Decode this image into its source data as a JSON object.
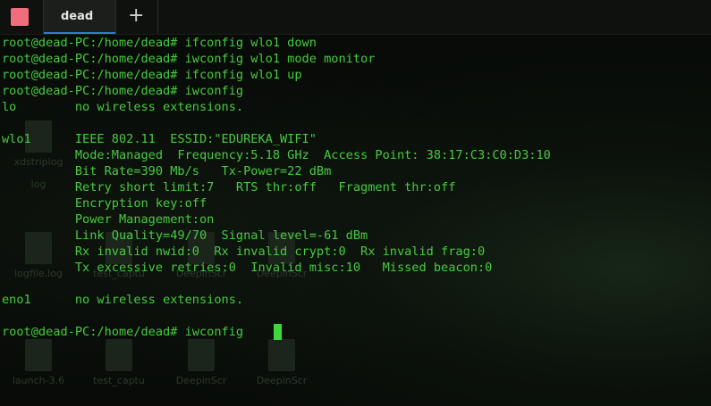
{
  "tab": {
    "label": "dead",
    "new_tab": "+"
  },
  "desktop_icons": [
    {
      "label": "xdstriplog"
    },
    {
      "label": "log"
    },
    {
      "label": "logfile.log"
    },
    {
      "label": "test_captu"
    },
    {
      "label": "DeepinScr"
    },
    {
      "label": "DeepinScr"
    },
    {
      "label": "launch-3.6"
    },
    {
      "label": "test_captu"
    },
    {
      "label": "DeepinScr"
    },
    {
      "label": "DeepinScr"
    }
  ],
  "terminal": {
    "lines": [
      "root@dead-PC:/home/dead# ifconfig wlo1 down",
      "root@dead-PC:/home/dead# iwconfig wlo1 mode monitor",
      "root@dead-PC:/home/dead# ifconfig wlo1 up",
      "root@dead-PC:/home/dead# iwconfig",
      "lo        no wireless extensions.",
      "",
      "wlo1      IEEE 802.11  ESSID:\"EDUREKA_WIFI\"",
      "          Mode:Managed  Frequency:5.18 GHz  Access Point: 38:17:C3:C0:D3:10",
      "          Bit Rate=390 Mb/s   Tx-Power=22 dBm",
      "          Retry short limit:7   RTS thr:off   Fragment thr:off",
      "          Encryption key:off",
      "          Power Management:on",
      "          Link Quality=49/70  Signal level=-61 dBm",
      "          Rx invalid nwid:0  Rx invalid crypt:0  Rx invalid frag:0",
      "          Tx excessive retries:0  Invalid misc:10   Missed beacon:0",
      "",
      "eno1      no wireless extensions.",
      "",
      "root@dead-PC:/home/dead# iwconfig "
    ]
  },
  "colors": {
    "text": "#47cc3e",
    "cursor": "#41d63c",
    "app_icon": "#f06e7c",
    "tab_accent": "#2e7cd6"
  }
}
